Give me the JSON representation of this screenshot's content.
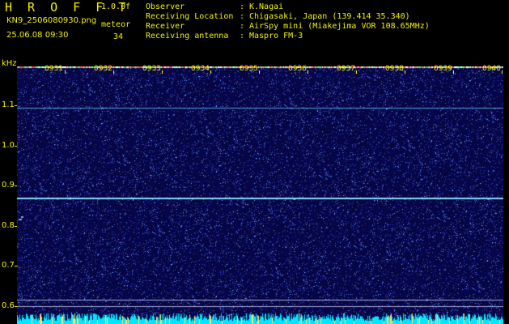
{
  "header": {
    "app_title": "H R O F F T",
    "version": "1.0.0f",
    "file_name": "KN9_2506080930.png",
    "meteor_label": "meteor",
    "datetime": "25.06.08 09:30",
    "meteor_count": "34"
  },
  "info": [
    {
      "label": "Observer",
      "value": "K.Nagai"
    },
    {
      "label": "Receiving Location",
      "value": "Chigasaki, Japan (139.414 35.340)"
    },
    {
      "label": "Receiver",
      "value": "AirSpy mini (Miakejima VOR 108.65MHz)"
    },
    {
      "label": "Receiving antenna",
      "value": "Maspro FM-3"
    }
  ],
  "axis": {
    "unit": "kHz",
    "y_ticks": [
      "1.1",
      "1.0",
      "0.9",
      "0.8",
      "0.7",
      "0.6"
    ],
    "x_ticks": [
      "0931",
      "0932",
      "0933",
      "0934",
      "0935",
      "0936",
      "0937",
      "0938",
      "0939",
      "0940"
    ]
  },
  "colors": {
    "text_primary": "#f2f200",
    "text_accent": "#2ce070",
    "background": "#000000",
    "noise": "#0a0a6a",
    "signal": "#70d8ff",
    "bottom_band": "#00e8ff"
  }
}
